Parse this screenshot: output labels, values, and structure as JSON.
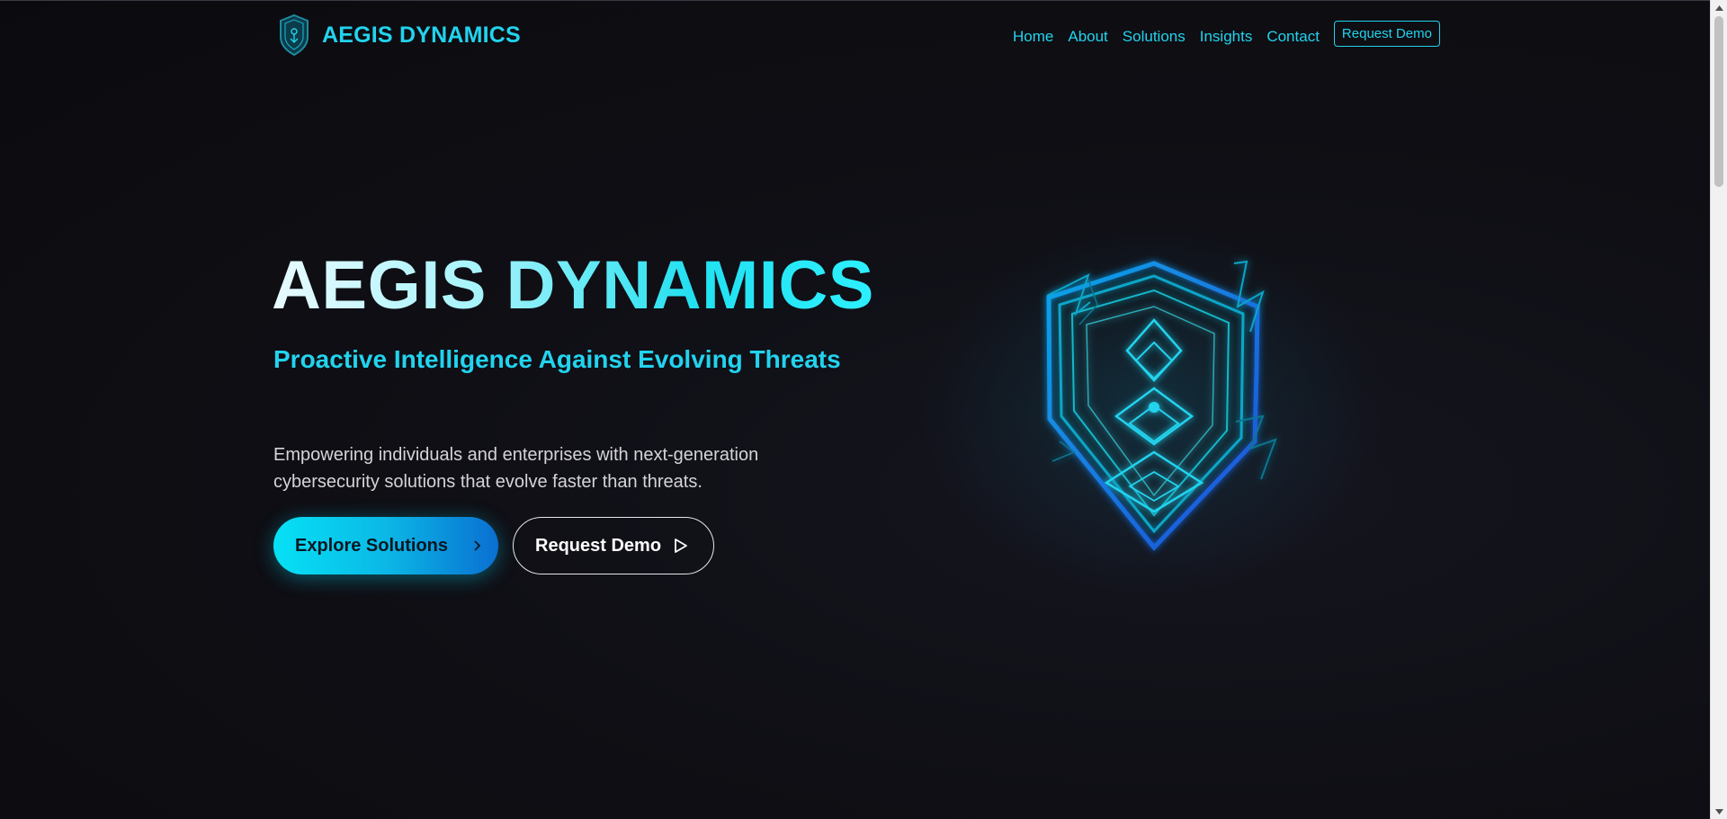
{
  "header": {
    "brand_name": "AEGIS DYNAMICS",
    "nav": [
      "Home",
      "About",
      "Solutions",
      "Insights",
      "Contact"
    ],
    "cta_label": "Request Demo"
  },
  "hero": {
    "title": "AEGIS DYNAMICS",
    "subtitle": "Proactive Intelligence Against Evolving Threats",
    "description": "Empowering individuals and enterprises with next-generation cybersecurity solutions that evolve faster than threats.",
    "primary_button": "Explore Solutions",
    "secondary_button": "Request Demo"
  },
  "icons": {
    "logo": "shield-logo-icon",
    "primary_button_icon": "chevron-right-icon",
    "secondary_button_icon": "play-icon",
    "hero_graphic": "shield-icon"
  },
  "colors": {
    "accent": "#22d3ee",
    "accent_blue": "#0a6fd1",
    "background": "#0c0c10",
    "text_muted": "#d4d4d8"
  }
}
